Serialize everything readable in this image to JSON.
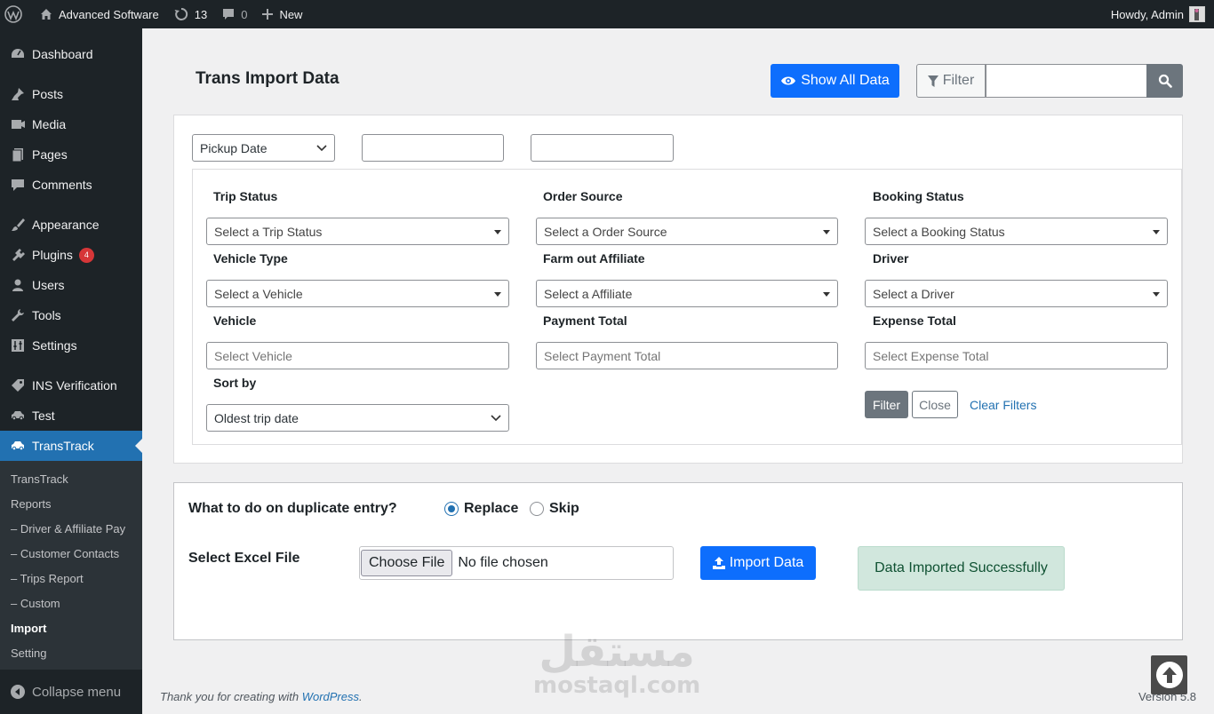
{
  "adminbar": {
    "site_name": "Advanced Software",
    "updates_count": "13",
    "comments_count": "0",
    "new_label": "New",
    "howdy": "Howdy, Admin"
  },
  "sidebar": {
    "items": [
      {
        "label": "Dashboard",
        "icon": "dashboard-icon"
      },
      {
        "label": "Posts",
        "icon": "pin-icon"
      },
      {
        "label": "Media",
        "icon": "media-icon"
      },
      {
        "label": "Pages",
        "icon": "pages-icon"
      },
      {
        "label": "Comments",
        "icon": "comment-icon"
      },
      {
        "label": "Appearance",
        "icon": "brush-icon"
      },
      {
        "label": "Plugins",
        "icon": "plug-icon",
        "badge": "4"
      },
      {
        "label": "Users",
        "icon": "user-icon"
      },
      {
        "label": "Tools",
        "icon": "wrench-icon"
      },
      {
        "label": "Settings",
        "icon": "sliders-icon"
      },
      {
        "label": "INS Verification",
        "icon": "tag-icon"
      },
      {
        "label": "Test",
        "icon": "car-icon"
      },
      {
        "label": "TransTrack",
        "icon": "car-icon"
      }
    ],
    "submenu": [
      "TransTrack",
      "Reports",
      "– Driver & Affiliate Pay",
      "– Customer Contacts",
      "– Trips Report",
      "– Custom",
      "Import",
      "Setting"
    ],
    "collapse_label": "Collapse menu"
  },
  "header": {
    "title": "Trans Import Data",
    "show_all_label": "Show All Data",
    "filter_label": "Filter"
  },
  "filters": {
    "date_type": "Pickup Date",
    "trip_status_label": "Trip Status",
    "trip_status_value": "Select a Trip Status",
    "order_source_label": "Order Source",
    "order_source_value": "Select a Order Source",
    "booking_status_label": "Booking Status",
    "booking_status_value": "Select a Booking Status",
    "vehicle_type_label": "Vehicle Type",
    "vehicle_type_value": "Select a Vehicle",
    "affiliate_label": "Farm out Affiliate",
    "affiliate_value": "Select a Affiliate",
    "driver_label": "Driver",
    "driver_value": "Select a Driver",
    "vehicle_label": "Vehicle",
    "vehicle_placeholder": "Select Vehicle",
    "payment_label": "Payment Total",
    "payment_placeholder": "Select Payment Total",
    "expense_label": "Expense Total",
    "expense_placeholder": "Select Expense Total",
    "sort_label": "Sort by",
    "sort_value": "Oldest trip date",
    "apply_label": "Filter",
    "close_label": "Close",
    "clear_label": "Clear Filters"
  },
  "import": {
    "duplicate_question": "What to do on duplicate entry?",
    "replace_label": "Replace",
    "skip_label": "Skip",
    "file_label": "Select Excel File",
    "choose_file": "Choose File",
    "no_file": "No file chosen",
    "import_label": "Import Data",
    "success_message": "Data Imported Successfully"
  },
  "footer": {
    "thanks_prefix": "Thank you for creating with",
    "wordpress_link": "WordPress",
    "version": "Version 5.8"
  },
  "watermark": {
    "arabic": "مستقل",
    "latin": "mostaql.com"
  },
  "colors": {
    "admin_dark": "#1d2327",
    "wp_blue": "#2271b1",
    "primary": "#0d6efd",
    "secondary": "#6c757d",
    "success_bg": "#d1e7dd"
  }
}
